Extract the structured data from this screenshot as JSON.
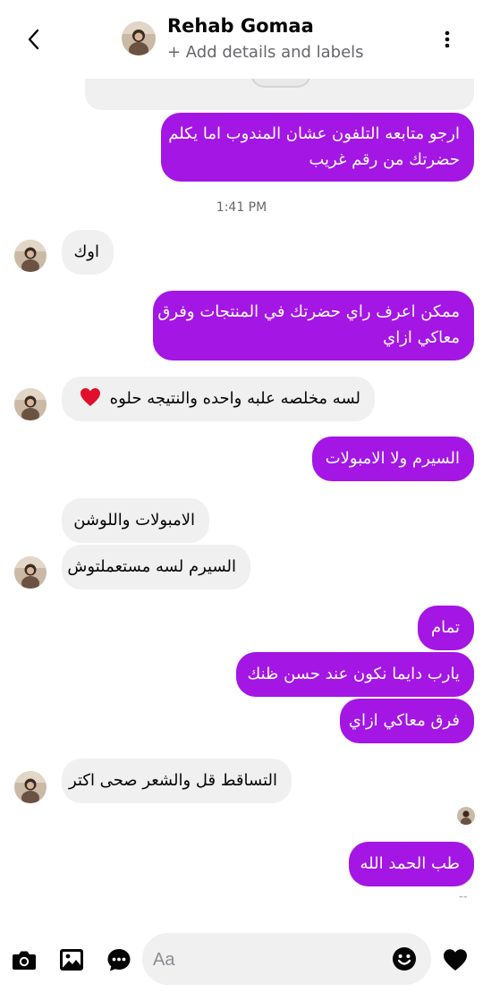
{
  "header": {
    "name": "Rehab Gomaa",
    "subtitle": "+ Add details and labels",
    "icons": [
      "back-arrow-icon",
      "avatar",
      "more-vertical-icon"
    ]
  },
  "messages": [
    {
      "direction": "outgoing",
      "text": "ارجو متابعه التلفون عشان المندوب اما يكلم حضرتك من رقم غريب",
      "line1": "ارجو متابعه التلفون عشان المندوب اما يكلم",
      "line2": "حضرتك من رقم غريب"
    },
    {
      "direction": "timestamp",
      "text": "1:41 PM"
    },
    {
      "direction": "incoming",
      "text": "اوك"
    },
    {
      "direction": "outgoing",
      "line1": "ممكن اعرف راي حضرتك في المنتجات وفرق",
      "line2": "معاكي ازاي"
    },
    {
      "direction": "incoming",
      "text": "لسه مخلصه علبه واحده  والنتيجه حلوه",
      "emoji": "❤️"
    },
    {
      "direction": "outgoing",
      "text": "السيرم ولا الامبولات"
    },
    {
      "direction": "incoming",
      "text": "الامبولات واللوشن"
    },
    {
      "direction": "incoming",
      "text": "السيرم لسه مستعملتوش"
    },
    {
      "direction": "outgoing",
      "text": "تمام"
    },
    {
      "direction": "outgoing",
      "text": "يارب دايما نكون عند حسن ظنك"
    },
    {
      "direction": "outgoing",
      "text": "فرق معاكي ازاي"
    },
    {
      "direction": "incoming",
      "text": "التساقط قل والشعر صحى اكتر"
    },
    {
      "direction": "outgoing",
      "text": "طب الحمد الله"
    }
  ],
  "composer": {
    "placeholder": "Aa",
    "icons": [
      "camera-icon",
      "gallery-icon",
      "chat-bubble-icon",
      "emoji-icon",
      "heart-icon"
    ]
  },
  "colors": {
    "outgoing_bubble": "#a416e4",
    "incoming_bubble": "#f0f0f0",
    "secondary_text": "#65676b"
  }
}
